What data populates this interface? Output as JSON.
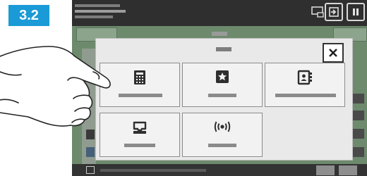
{
  "step_label": "3.2",
  "dialog": {
    "tiles": [
      {
        "icon": "keypad-icon"
      },
      {
        "icon": "star-icon"
      },
      {
        "icon": "address-book-icon"
      },
      {
        "icon": "inbox-tray-icon"
      },
      {
        "icon": "broadcast-icon"
      }
    ],
    "close_icon": "close-icon"
  },
  "colors": {
    "badge": "#1a9ad6",
    "topbar": "#2f2f2f",
    "dialog_bg": "#e9e9e9",
    "tile_bg": "#f2f2f2",
    "dim_screen": "#6d8a6d"
  }
}
